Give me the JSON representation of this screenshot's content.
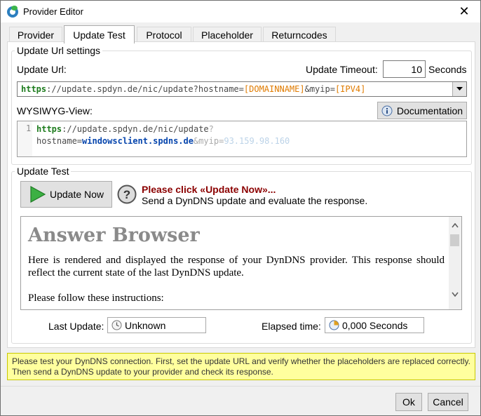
{
  "window": {
    "title": "Provider Editor",
    "close_glyph": "✕"
  },
  "tabs": [
    {
      "label": "Provider"
    },
    {
      "label": "Update Test"
    },
    {
      "label": "Protocol"
    },
    {
      "label": "Placeholder"
    },
    {
      "label": "Returncodes"
    }
  ],
  "update_url_settings": {
    "group_label": "Update Url settings",
    "url_label": "Update Url:",
    "timeout_label": "Update Timeout:",
    "timeout_value": "10",
    "timeout_unit": "Seconds",
    "url_value": {
      "scheme": "https",
      "rest": "://update.spdyn.de/nic/update?hostname=",
      "ph1": "[DOMAINNAME]",
      "mid": "&myip=",
      "ph2": "[IPV4]"
    },
    "wysiwyg_label": "WYSIWYG-View:",
    "documentation_button": "Documentation",
    "editor": {
      "line_number": "1",
      "line1_scheme": "https",
      "line1_rest": "://update.spdyn.de/nic/update",
      "line1_q": "?",
      "line2_key": "hostname=",
      "line2_host": "windowsclient.spdns.de",
      "line2_amp": "&myip=",
      "line2_ip": "93.159.98.160"
    }
  },
  "update_test": {
    "group_label": "Update Test",
    "update_now_button": "Update Now",
    "prompt_title": "Please click «Update Now»...",
    "prompt_text": "Send a DynDNS update and evaluate the response.",
    "answer": {
      "heading": "Answer Browser",
      "paragraph1": "Here is rendered and displayed the response of your DynDNS provider. This response should reflect the current state of the last DynDNS update.",
      "paragraph2": "Please follow these instructions:"
    },
    "last_update_label": "Last Update:",
    "last_update_value": "Unknown",
    "elapsed_label": "Elapsed time:",
    "elapsed_value": "0,000 Seconds"
  },
  "info_bar": {
    "text": "Please test your DynDNS connection. First, set the update URL and verify whether the placeholders are replaced correctly. Then send a DynDNS update to your provider and check its response."
  },
  "footer": {
    "ok_button": "Ok",
    "cancel_button": "Cancel"
  },
  "icons": {
    "app": "app-icon",
    "close": "close-icon",
    "dropdown": "chevron-down-icon",
    "info": "info-icon",
    "play": "play-icon",
    "help": "help-icon",
    "clock": "clock-icon",
    "timer": "timer-icon"
  },
  "colors": {
    "accent_green": "#3cb043",
    "prompt_red": "#8b0000",
    "info_bg": "#ffff9e"
  }
}
